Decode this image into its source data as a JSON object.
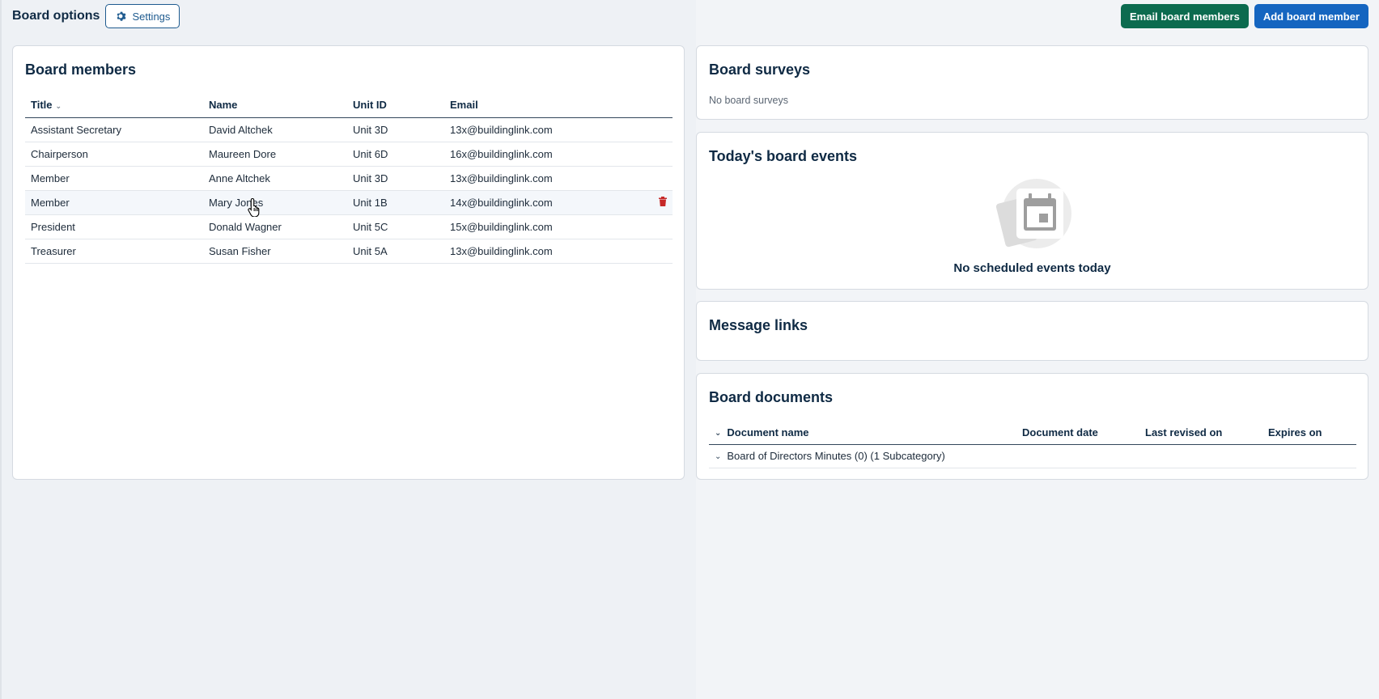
{
  "header": {
    "title": "Board options",
    "settings_label": "Settings",
    "email_label": "Email board members",
    "add_label": "Add board member"
  },
  "members": {
    "title": "Board members",
    "columns": [
      "Title",
      "Name",
      "Unit ID",
      "Email"
    ],
    "rows": [
      {
        "title": "Assistant Secretary",
        "name": "David Altchek",
        "unit": "Unit 3D",
        "email": "13x@buildinglink.com"
      },
      {
        "title": "Chairperson",
        "name": "Maureen Dore",
        "unit": "Unit 6D",
        "email": "16x@buildinglink.com"
      },
      {
        "title": "Member",
        "name": "Anne Altchek",
        "unit": "Unit 3D",
        "email": "13x@buildinglink.com"
      },
      {
        "title": "Member",
        "name": "Mary Jones",
        "unit": "Unit 1B",
        "email": "14x@buildinglink.com"
      },
      {
        "title": "President",
        "name": "Donald Wagner",
        "unit": "Unit 5C",
        "email": "15x@buildinglink.com"
      },
      {
        "title": "Treasurer",
        "name": "Susan Fisher",
        "unit": "Unit 5A",
        "email": "13x@buildinglink.com"
      }
    ]
  },
  "surveys": {
    "title": "Board surveys",
    "empty": "No board surveys"
  },
  "events": {
    "title": "Today's board events",
    "empty": "No scheduled events today"
  },
  "links": {
    "title": "Message links"
  },
  "documents": {
    "title": "Board documents",
    "columns": [
      "Document name",
      "Document date",
      "Last revised on",
      "Expires on"
    ],
    "rows": [
      {
        "name": "Board of Directors Minutes (0) (1 Subcategory)"
      }
    ]
  },
  "colors": {
    "green": "#0c6b4f",
    "blue": "#1565c0",
    "danger": "#c62828"
  },
  "icons": [
    "gear-icon",
    "trash-icon",
    "calendar-icon",
    "chevron-down-icon",
    "hand-cursor-icon"
  ]
}
